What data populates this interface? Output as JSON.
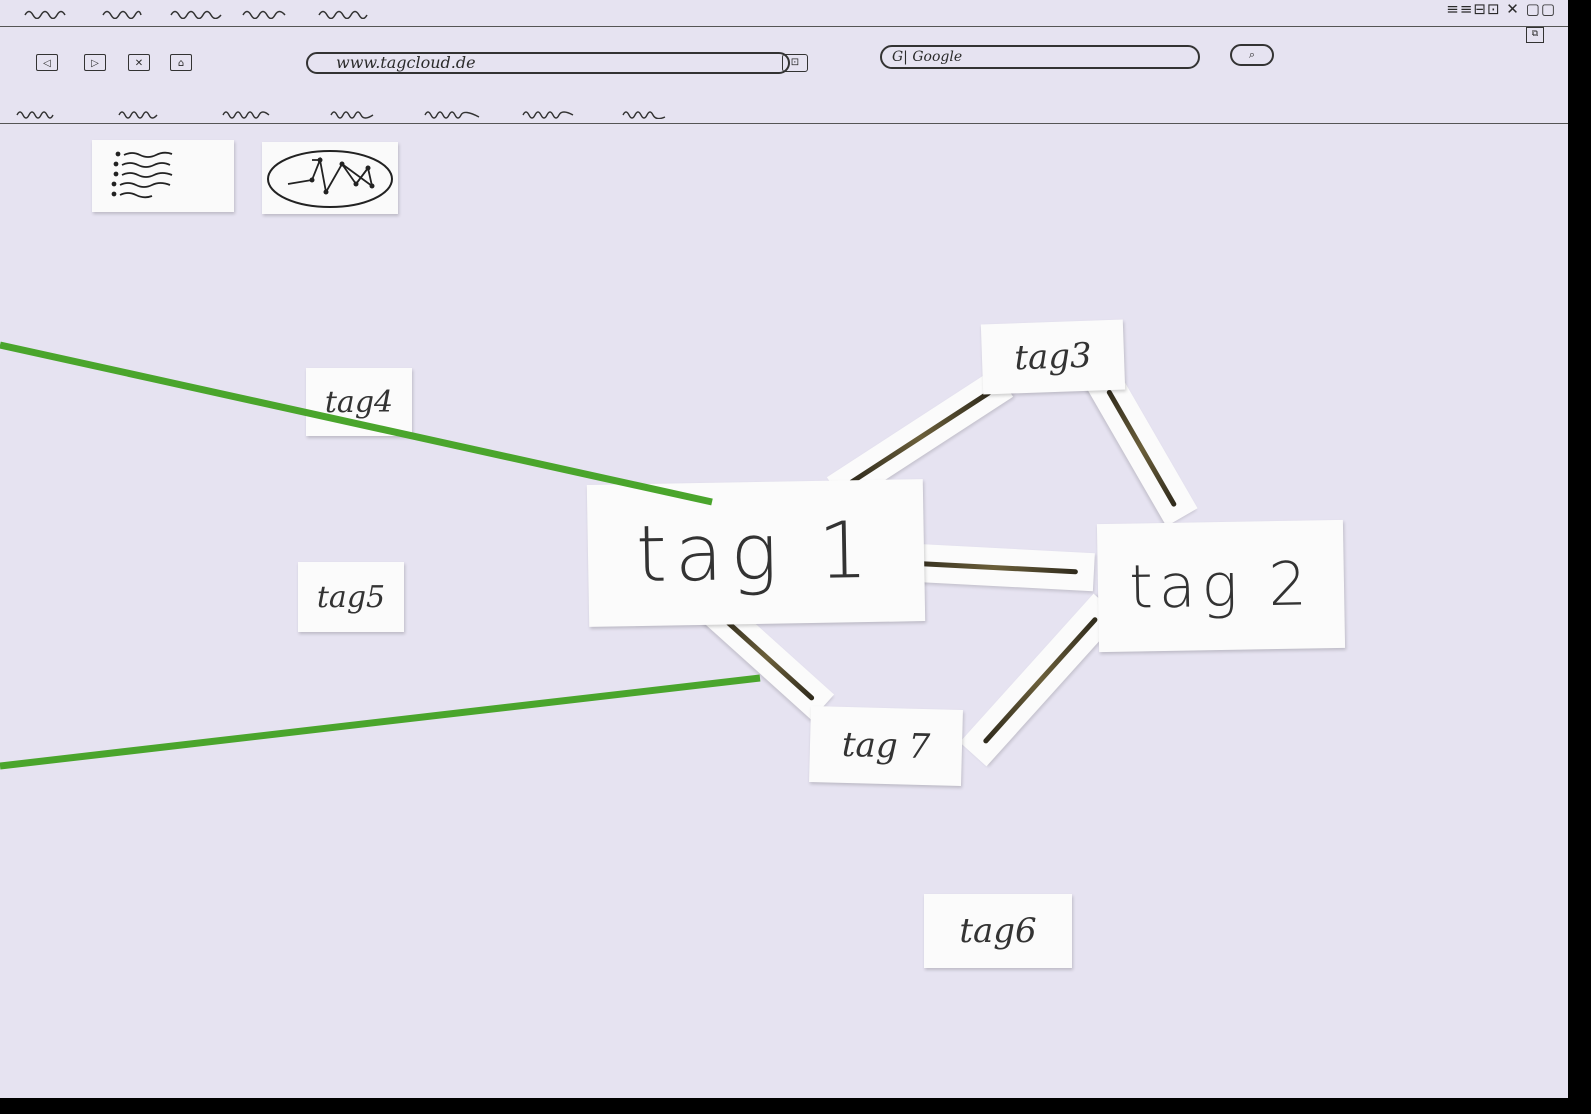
{
  "browser": {
    "url": "www.tagcloud.de",
    "search_engine": "G| Google",
    "window_controls": "≡≡⊟⊡ ✕ ▢▢"
  },
  "nav_buttons": [
    "◁",
    "▷",
    "✕",
    "⌂"
  ],
  "view_toggles": {
    "list_icon": "list-icon",
    "graph_icon": "graph-network-icon"
  },
  "tags": {
    "tag1": "tag 1",
    "tag2": "tag 2",
    "tag3": "tag3",
    "tag4": "tag4",
    "tag5": "tag5",
    "tag6": "tag6",
    "tag7": "tag 7"
  },
  "colors": {
    "paper": "#e6e3f1",
    "pointer_line": "#4aa52c",
    "ink": "#2a2a2a"
  }
}
